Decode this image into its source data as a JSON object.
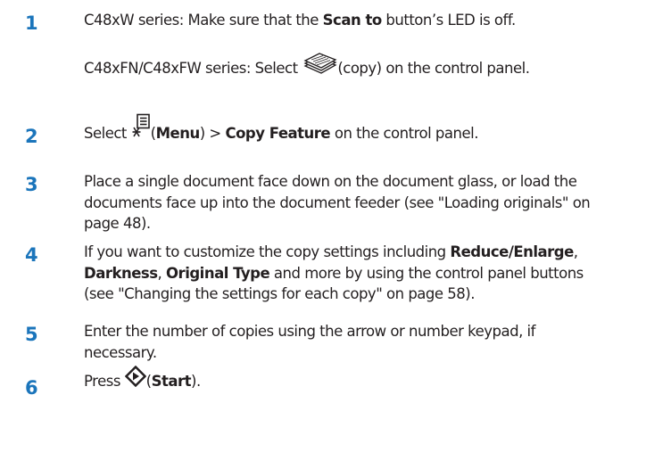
{
  "steps": [
    {
      "number": "1",
      "lines": [
        {
          "prefix": "C48xW series: Make sure that the ",
          "bold": "Scan to",
          "suffix": " button’s LED is off."
        }
      ],
      "sub_prefix": "C48xFN/C48xFW series: Select ",
      "sub_suffix": "(copy) on the control panel.",
      "sub_icon": "copy-icon"
    },
    {
      "number": "2",
      "prefix": "Select ",
      "icon": "menu-icon",
      "paren_open": "(",
      "bold1": "Menu",
      "mid": ") > ",
      "bold2": "Copy Feature",
      "suffix": " on the control panel."
    },
    {
      "number": "3",
      "lines": [
        "Place a single document face down on the document glass, or load the",
        "documents face up into the document feeder (see \"Loading originals\" on",
        "page 48)."
      ]
    },
    {
      "number": "4",
      "line1_prefix": "If you want to customize the copy settings including ",
      "line1_bold": "Reduce/Enlarge",
      "line1_suffix": ",",
      "line2_bold1": "Darkness",
      "line2_sep": ", ",
      "line2_bold2": "Original Type",
      "line2_suffix": " and more by using the control panel buttons",
      "line3": "(see \"Changing the settings for each copy\" on page 58)."
    },
    {
      "number": "5",
      "lines": [
        "Enter the number of copies using the arrow or number keypad, if",
        "necessary."
      ]
    },
    {
      "number": "6",
      "prefix": "Press ",
      "icon": "start-icon",
      "paren_open": "(",
      "bold": "Start",
      "suffix": ")."
    }
  ]
}
